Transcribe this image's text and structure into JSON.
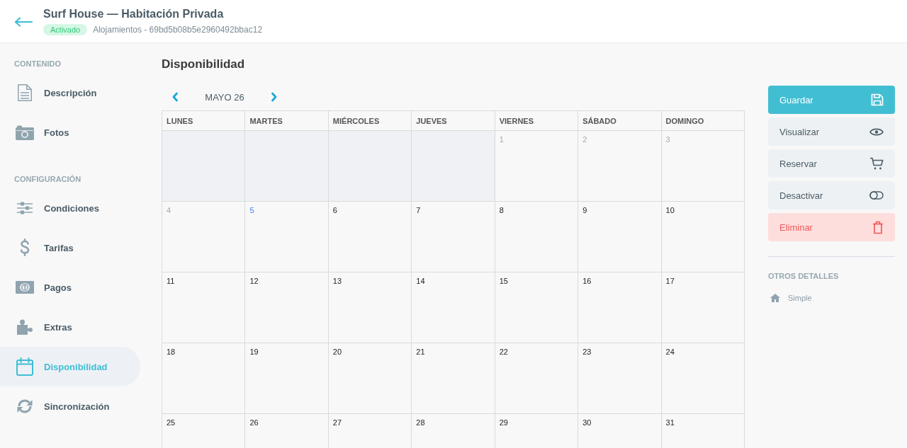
{
  "header": {
    "title": "Surf House — Habitación Privada",
    "status": "Activado",
    "subtitle": "Alojamientos - 69bd5b08b5e2960492bbac12"
  },
  "sidebar": {
    "sections": [
      {
        "title": "CONTENIDO",
        "items": [
          {
            "label": "Descripción",
            "selected": false
          },
          {
            "label": "Fotos",
            "selected": false
          }
        ]
      },
      {
        "title": "CONFIGURACIÓN",
        "items": [
          {
            "label": "Condiciones",
            "selected": false
          },
          {
            "label": "Tarifas",
            "selected": false
          },
          {
            "label": "Pagos",
            "selected": false
          },
          {
            "label": "Extras",
            "selected": false
          },
          {
            "label": "Disponibilidad",
            "selected": true
          },
          {
            "label": "Sincronización",
            "selected": false
          }
        ]
      }
    ]
  },
  "main": {
    "title": "Disponibilidad",
    "calendar": {
      "month": "MAYO 26",
      "weekdays": [
        "LUNES",
        "MARTES",
        "MIÉRCOLES",
        "JUEVES",
        "VIERNES",
        "SÁBADO",
        "DOMINGO"
      ],
      "weeks": [
        [
          {
            "day": "1",
            "disabled": true,
            "today": false
          },
          {
            "day": "2",
            "disabled": true,
            "today": false
          },
          {
            "day": "3",
            "disabled": true,
            "today": false
          }
        ],
        [
          {
            "day": "4",
            "disabled": true,
            "today": false
          },
          {
            "day": "5",
            "disabled": false,
            "today": true
          },
          {
            "day": "6",
            "disabled": false,
            "today": false
          },
          {
            "day": "7",
            "disabled": false,
            "today": false
          },
          {
            "day": "8",
            "disabled": false,
            "today": false
          },
          {
            "day": "9",
            "disabled": false,
            "today": false
          },
          {
            "day": "10",
            "disabled": false,
            "today": false
          }
        ],
        [
          {
            "day": "11",
            "disabled": false,
            "today": false
          },
          {
            "day": "12",
            "disabled": false,
            "today": false
          },
          {
            "day": "13",
            "disabled": false,
            "today": false
          },
          {
            "day": "14",
            "disabled": false,
            "today": false
          },
          {
            "day": "15",
            "disabled": false,
            "today": false
          },
          {
            "day": "16",
            "disabled": false,
            "today": false
          },
          {
            "day": "17",
            "disabled": false,
            "today": false
          }
        ],
        [
          {
            "day": "18",
            "disabled": false,
            "today": false
          },
          {
            "day": "19",
            "disabled": false,
            "today": false
          },
          {
            "day": "20",
            "disabled": false,
            "today": false
          },
          {
            "day": "21",
            "disabled": false,
            "today": false
          },
          {
            "day": "22",
            "disabled": false,
            "today": false
          },
          {
            "day": "23",
            "disabled": false,
            "today": false
          },
          {
            "day": "24",
            "disabled": false,
            "today": false
          }
        ],
        [
          {
            "day": "25",
            "disabled": false,
            "today": false
          },
          {
            "day": "26",
            "disabled": false,
            "today": false
          },
          {
            "day": "27",
            "disabled": false,
            "today": false
          },
          {
            "day": "28",
            "disabled": false,
            "today": false
          },
          {
            "day": "29",
            "disabled": false,
            "today": false
          },
          {
            "day": "30",
            "disabled": false,
            "today": false
          },
          {
            "day": "31",
            "disabled": false,
            "today": false
          }
        ]
      ]
    }
  },
  "actions": {
    "buttons": [
      {
        "label": "Guardar",
        "kind": "primary"
      },
      {
        "label": "Visualizar",
        "kind": "secondary"
      },
      {
        "label": "Reservar",
        "kind": "secondary"
      },
      {
        "label": "Desactivar",
        "kind": "secondary"
      },
      {
        "label": "Eliminar",
        "kind": "danger"
      }
    ],
    "details_title": "OTROS DETALLES",
    "details": [
      {
        "label": "Simple"
      }
    ]
  }
}
